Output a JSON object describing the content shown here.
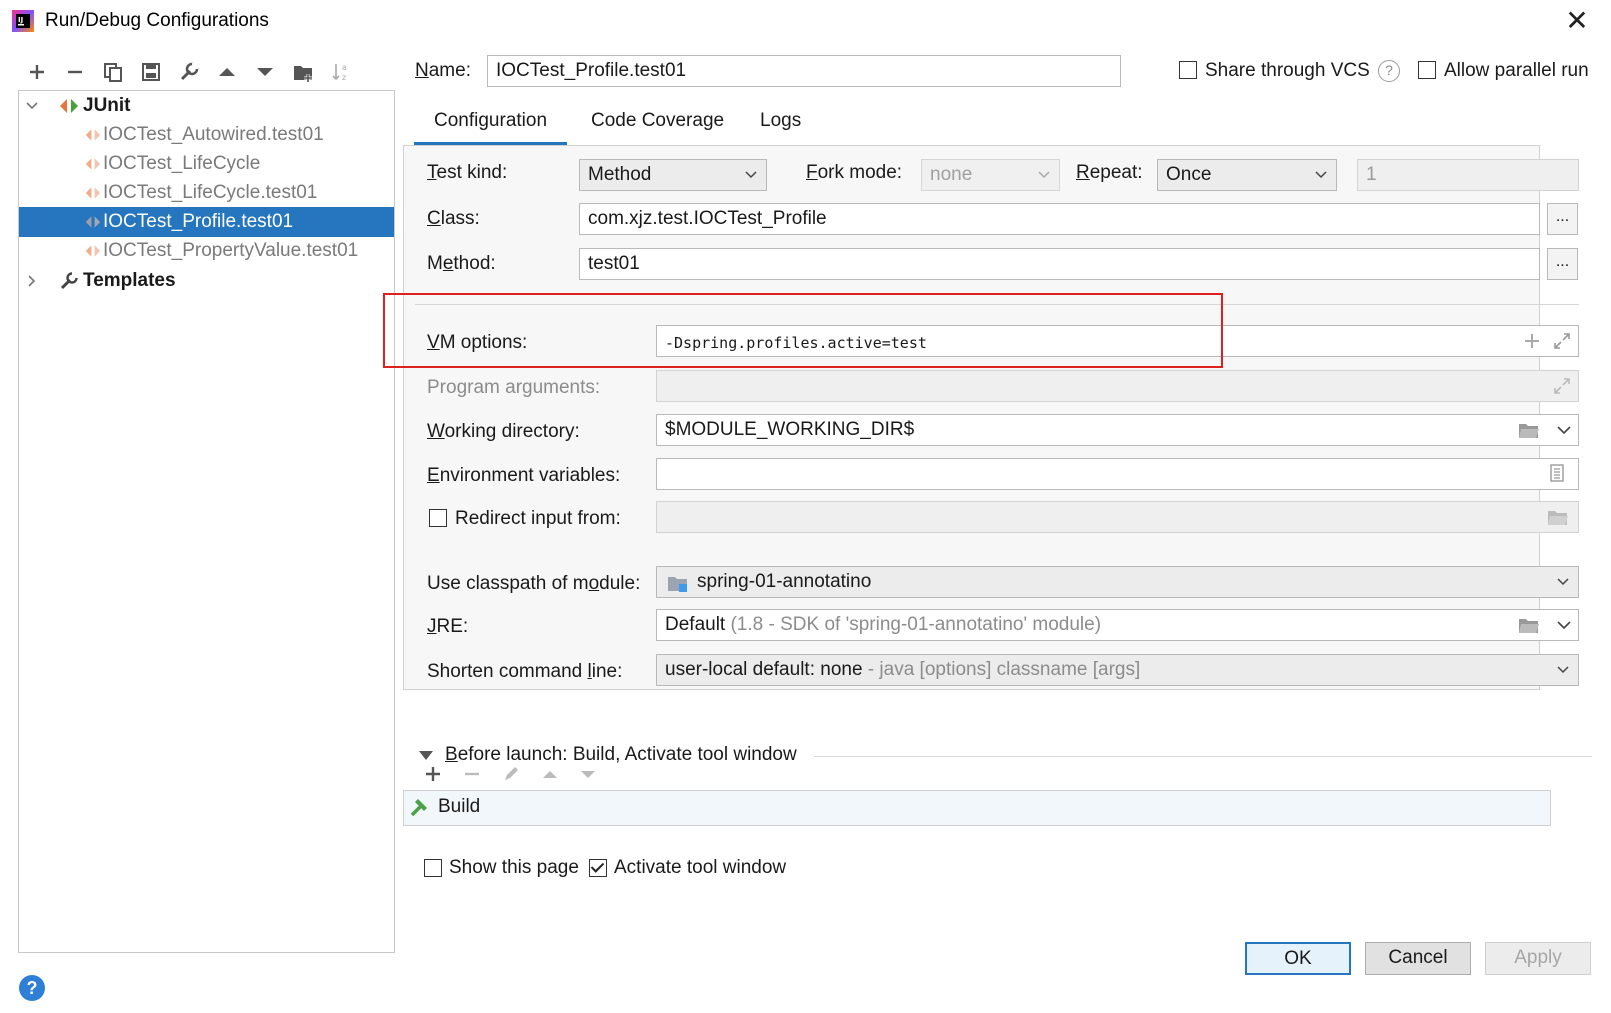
{
  "window": {
    "title": "Run/Debug Configurations"
  },
  "toolbar": {
    "items": [
      "add-icon",
      "remove-icon",
      "copy-icon",
      "save-icon",
      "wrench-icon",
      "move-up-icon",
      "move-down-icon",
      "folder-add-icon",
      "sort-icon"
    ]
  },
  "tree": {
    "root": "JUnit",
    "children": [
      "IOCTest_Autowired.test01",
      "IOCTest_LifeCycle",
      "IOCTest_LifeCycle.test01",
      "IOCTest_Profile.test01",
      "IOCTest_PropertyValue.test01"
    ],
    "selected_index": 3,
    "templates": "Templates"
  },
  "name_row": {
    "label": "Name:",
    "value": "IOCTest_Profile.test01",
    "share_vcs": "Share through VCS",
    "allow_parallel": "Allow parallel run"
  },
  "tabs": [
    "Configuration",
    "Code Coverage",
    "Logs"
  ],
  "config": {
    "test_kind_label": "Test kind:",
    "test_kind": "Method",
    "fork_mode_label": "Fork mode:",
    "fork_mode": "none",
    "repeat_label": "Repeat:",
    "repeat": "Once",
    "repeat_count": "1",
    "class_label": "Class:",
    "class_value": "com.xjz.test.IOCTest_Profile",
    "method_label": "Method:",
    "method_value": "test01",
    "dots": "...",
    "vm_label": "VM options:",
    "vm_value": "-Dspring.profiles.active=test",
    "prog_label": "Program arguments:",
    "workdir_label": "Working directory:",
    "workdir_value": "$MODULE_WORKING_DIR$",
    "env_label": "Environment variables:",
    "redirect_label": "Redirect input from:",
    "classpath_label": "Use classpath of module:",
    "classpath_value": "spring-01-annotatino",
    "jre_label": "JRE:",
    "jre_value": "Default",
    "jre_hint": "(1.8 - SDK of 'spring-01-annotatino' module)",
    "shorten_label": "Shorten command line:",
    "shorten_value": "user-local default: none",
    "shorten_hint": "- java [options] classname [args]"
  },
  "before_launch": {
    "title": "Before launch: Build, Activate tool window",
    "item": "Build",
    "show_page": "Show this page",
    "activate": "Activate tool window"
  },
  "buttons": {
    "ok": "OK",
    "cancel": "Cancel",
    "apply": "Apply"
  },
  "colors": {
    "accent": "#2675bf",
    "highlight_box": "#e02020"
  }
}
